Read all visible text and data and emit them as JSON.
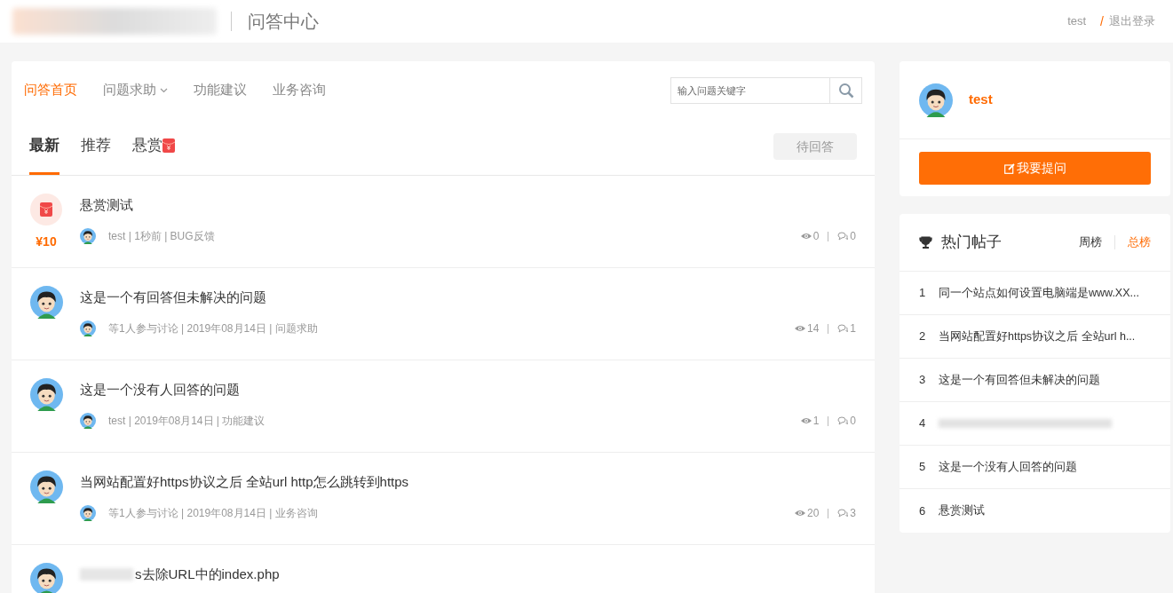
{
  "header": {
    "title": "问答中心",
    "user": "test",
    "separator": "/",
    "logout": "退出登录"
  },
  "nav": [
    {
      "label": "问答首页",
      "selected": true,
      "dropdown": false
    },
    {
      "label": "问题求助",
      "selected": false,
      "dropdown": true
    },
    {
      "label": "功能建议",
      "selected": false,
      "dropdown": false
    },
    {
      "label": "业务咨询",
      "selected": false,
      "dropdown": false
    }
  ],
  "search": {
    "placeholder": "输入问题关键字"
  },
  "tabs": [
    {
      "label": "最新",
      "selected": true,
      "kind": "plain"
    },
    {
      "label": "推荐",
      "selected": false,
      "kind": "plain"
    },
    {
      "label": "悬赏",
      "selected": false,
      "kind": "reward"
    }
  ],
  "filter_button": "待回答",
  "posts": [
    {
      "kind": "reward",
      "reward": "¥10",
      "title": "悬赏测试",
      "meta": "test | 1秒前 | BUG反馈",
      "views": "0",
      "answers": "0"
    },
    {
      "kind": "normal",
      "title": "这是一个有回答但未解决的问题",
      "meta": "等1人参与讨论 | 2019年08月14日 | 问题求助",
      "views": "14",
      "answers": "1"
    },
    {
      "kind": "normal",
      "title": "这是一个没有人回答的问题",
      "meta": "test | 2019年08月14日 | 功能建议",
      "views": "1",
      "answers": "0"
    },
    {
      "kind": "normal",
      "title": "当网站配置好https协议之后 全站url http怎么跳转到https",
      "meta": "等1人参与讨论 | 2019年08月14日 | 业务咨询",
      "views": "20",
      "answers": "3"
    },
    {
      "kind": "blurred",
      "title": "s去除URL中的index.php"
    }
  ],
  "profile": {
    "name": "test",
    "ask_button": "我要提问"
  },
  "hot": {
    "title": "热门帖子",
    "tabs": [
      {
        "label": "周榜",
        "selected": false
      },
      {
        "label": "总榜",
        "selected": true
      }
    ],
    "items": [
      {
        "rank": "1",
        "title": "同一个站点如何设置电脑端是www.XX...",
        "kind": "text"
      },
      {
        "rank": "2",
        "title": "当网站配置好https协议之后 全站url h...",
        "kind": "text"
      },
      {
        "rank": "3",
        "title": "这是一个有回答但未解决的问题",
        "kind": "text"
      },
      {
        "rank": "4",
        "kind": "blurred"
      },
      {
        "rank": "5",
        "title": "这是一个没有人回答的问题",
        "kind": "text"
      },
      {
        "rank": "6",
        "title": "悬赏测试",
        "kind": "text"
      }
    ]
  }
}
